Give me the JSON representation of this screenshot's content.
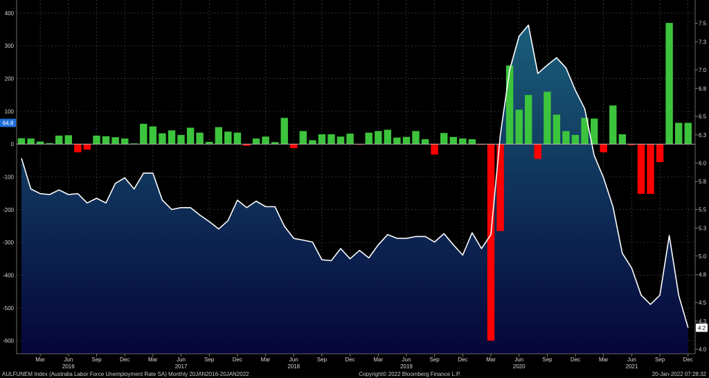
{
  "chart_data": {
    "type": "bar",
    "title": "",
    "left_axis": {
      "ylim": [
        -640,
        440
      ],
      "ticks": [
        400,
        300,
        200,
        100,
        0,
        -100,
        -200,
        -300,
        -400,
        -500,
        -600
      ]
    },
    "right_axis": {
      "ylim": [
        3.95,
        7.75
      ],
      "ticks": [
        "7.5",
        "7.3",
        "7.0",
        "6.8",
        "6.5",
        "6.3",
        "6.0",
        "5.8",
        "5.5",
        "5.3",
        "5.0",
        "4.8",
        "4.5",
        "4.3",
        "4.0"
      ]
    },
    "x_range": [
      "2016-01",
      "2021-12"
    ],
    "month_labels": [
      {
        "m": 2,
        "label": "Mar"
      },
      {
        "m": 5,
        "label": "Jun",
        "year": "2016"
      },
      {
        "m": 8,
        "label": "Sep"
      },
      {
        "m": 11,
        "label": "Dec"
      },
      {
        "m": 14,
        "label": "Mar"
      },
      {
        "m": 17,
        "label": "Jun",
        "year": "2017"
      },
      {
        "m": 20,
        "label": "Sep"
      },
      {
        "m": 23,
        "label": "Dec"
      },
      {
        "m": 26,
        "label": "Mar"
      },
      {
        "m": 29,
        "label": "Jun",
        "year": "2018"
      },
      {
        "m": 32,
        "label": "Sep"
      },
      {
        "m": 35,
        "label": "Dec"
      },
      {
        "m": 38,
        "label": "Mar"
      },
      {
        "m": 41,
        "label": "Jun",
        "year": "2019"
      },
      {
        "m": 44,
        "label": "Sep"
      },
      {
        "m": 47,
        "label": "Dec"
      },
      {
        "m": 50,
        "label": "Mar"
      },
      {
        "m": 53,
        "label": "Jun",
        "year": "2020"
      },
      {
        "m": 56,
        "label": "Sep"
      },
      {
        "m": 59,
        "label": "Dec"
      },
      {
        "m": 62,
        "label": "Mar"
      },
      {
        "m": 65,
        "label": "Jun",
        "year": "2021"
      },
      {
        "m": 68,
        "label": "Sep"
      },
      {
        "m": 71,
        "label": "Dec"
      }
    ],
    "bar_series": {
      "axis": "left",
      "positive_color": "#3dc43d",
      "negative_color": "#ff0000",
      "values": [
        18,
        17,
        8,
        3,
        26,
        27,
        -25,
        -17,
        26,
        24,
        21,
        17,
        2,
        62,
        54,
        33,
        42,
        28,
        50,
        35,
        7,
        52,
        38,
        35,
        -5,
        17,
        23,
        6,
        80,
        -12,
        40,
        12,
        30,
        30,
        23,
        32,
        -2,
        35,
        40,
        44,
        20,
        22,
        40,
        15,
        -32,
        34,
        22,
        17,
        15,
        -2,
        -600,
        -265,
        240,
        105,
        150,
        -45,
        160,
        90,
        40,
        28,
        80,
        78,
        -25,
        118,
        30,
        -3,
        -152,
        -152,
        -55,
        370,
        65,
        64.8
      ]
    },
    "line_series": {
      "axis": "right",
      "line_color": "#ffffff",
      "values": [
        6.05,
        5.72,
        5.67,
        5.66,
        5.71,
        5.66,
        5.67,
        5.57,
        5.62,
        5.57,
        5.78,
        5.84,
        5.72,
        5.89,
        5.89,
        5.6,
        5.5,
        5.52,
        5.52,
        5.44,
        5.37,
        5.29,
        5.38,
        5.6,
        5.52,
        5.59,
        5.53,
        5.53,
        5.32,
        5.19,
        5.17,
        5.15,
        4.96,
        4.95,
        5.08,
        4.97,
        5.06,
        4.98,
        5.12,
        5.23,
        5.19,
        5.19,
        5.21,
        5.21,
        5.15,
        5.24,
        5.12,
        5.01,
        5.25,
        5.08,
        5.23,
        6.3,
        7.0,
        7.36,
        7.48,
        6.96,
        7.05,
        7.13,
        7.02,
        6.78,
        6.58,
        6.08,
        5.84,
        5.53,
        5.03,
        4.87,
        4.58,
        4.48,
        4.58,
        5.22,
        4.58,
        4.23
      ]
    },
    "current_bar_value": "64.8",
    "current_line_value": "4.2",
    "footer": {
      "left": "AULFUNEM Index (Australia Labor Force Unemployment Rate SA)  Monthly 20JAN2016-20JAN2022",
      "center": "Copyright© 2022 Bloomberg Finance L.P.",
      "right": "20-Jan-2022 07:28:32"
    },
    "grid": true,
    "colors": {
      "background": "#000000",
      "area_top": "#1a5f7a",
      "area_bottom": "#05053a",
      "grid": "#555555"
    }
  }
}
